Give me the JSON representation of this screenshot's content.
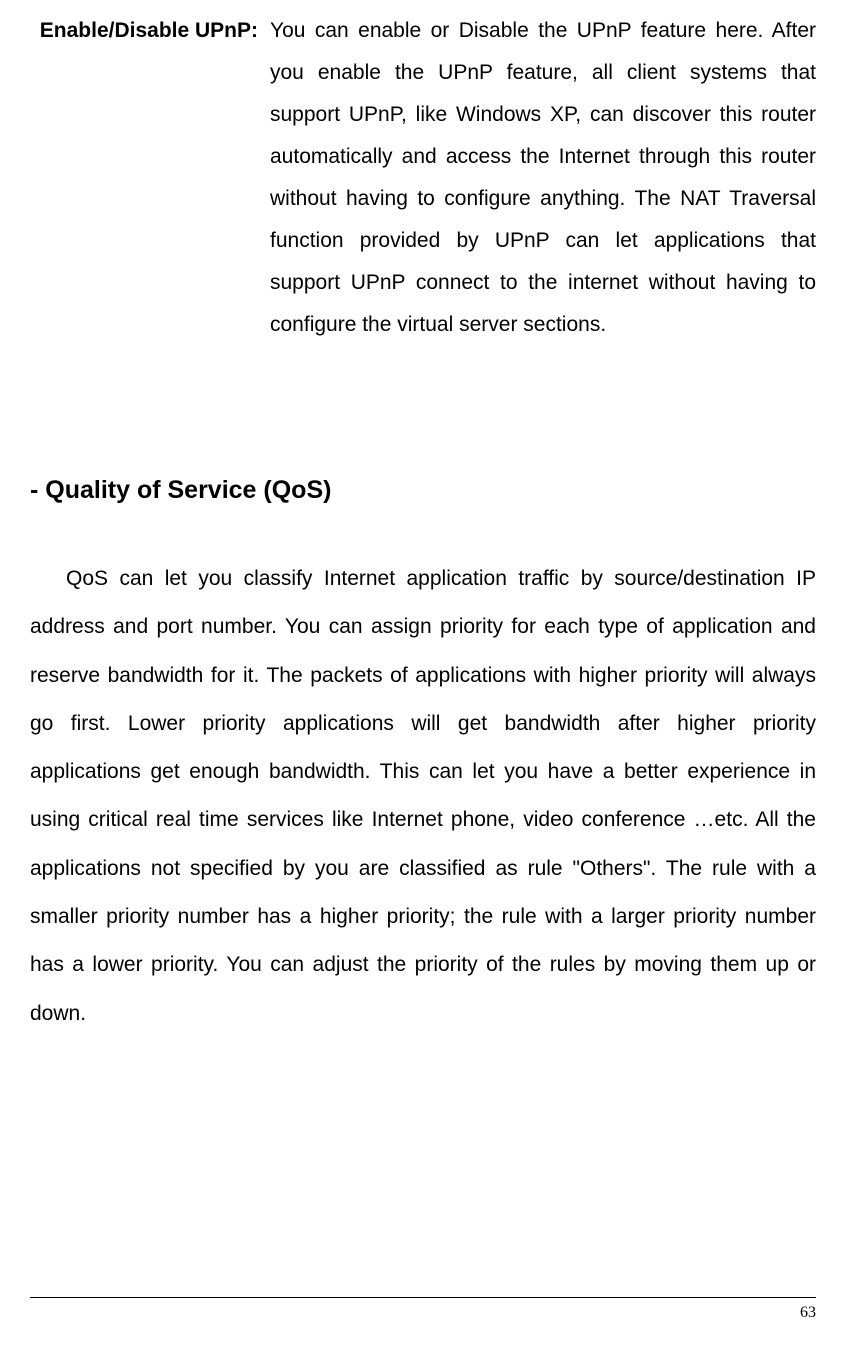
{
  "param": {
    "label": "Enable/Disable UPnP:",
    "desc": "You can enable or Disable the UPnP feature here. After you enable the UPnP feature, all client systems that support UPnP, like Windows XP, can discover this router automatically and access the Internet through this router without having to configure anything. The NAT Traversal function provided by UPnP can let applications that support UPnP connect to the internet without having to configure the virtual server sections."
  },
  "section": {
    "heading": "- Quality of Service (QoS)",
    "body": "QoS can let you classify Internet application traffic by source/destination IP address and port number. You can assign priority for each type of application and reserve bandwidth for it. The packets of applications with higher priority will always go first. Lower priority applications will get bandwidth after higher priority applications get enough bandwidth. This can let you have a better experience in using critical real time services like Internet phone, video conference …etc. All the applications not specified by you are classified as rule \"Others\". The rule with a smaller priority number has a higher priority; the rule with a larger priority number has a lower priority. You can adjust the priority of the rules by moving them up or down."
  },
  "page_number": "63"
}
